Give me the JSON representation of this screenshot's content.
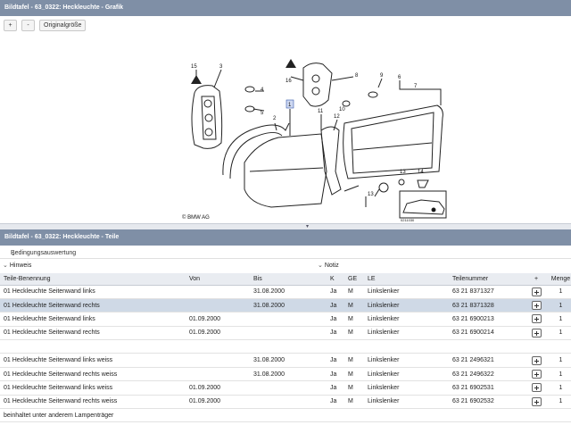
{
  "top_panel": {
    "title": "Bildtafel - 63_0322: Heckleuchte - Grafik"
  },
  "toolbar": {
    "zoom_in": "+",
    "zoom_out": "-",
    "original": "Originalgröße"
  },
  "diagram": {
    "callouts": [
      "15",
      "3",
      "4",
      "5",
      "16",
      "8",
      "9",
      "6",
      "7",
      "1",
      "2",
      "11",
      "12",
      "10",
      "13",
      "14",
      "13"
    ],
    "brand": "© BMW AG",
    "code": "0211030"
  },
  "bottom_panel": {
    "title": "Bildtafel - 63_0322: Heckleuchte - Teile"
  },
  "filters": {
    "conditions": "Bedingungsauswertung",
    "hint": "Hinweis",
    "notes": "Notiz"
  },
  "table": {
    "headers": [
      "Teile-Benennung",
      "Von",
      "Bis",
      "K",
      "GE",
      "LE",
      "Teilenummer",
      "+",
      "Menge"
    ],
    "rows": [
      {
        "name": "01 Heckleuchte Seitenwand links",
        "from": "",
        "to": "31.08.2000",
        "k": "Ja",
        "ge": "M",
        "le": "Linkslenker",
        "part": "63 21 8371327",
        "cart": true,
        "qty": "1",
        "selected": false
      },
      {
        "name": "01 Heckleuchte Seitenwand rechts",
        "from": "",
        "to": "31.08.2000",
        "k": "Ja",
        "ge": "M",
        "le": "Linkslenker",
        "part": "63 21 8371328",
        "cart": true,
        "qty": "1",
        "selected": true
      },
      {
        "name": "01 Heckleuchte Seitenwand links",
        "from": "01.09.2000",
        "to": "",
        "k": "Ja",
        "ge": "M",
        "le": "Linkslenker",
        "part": "63 21 6900213",
        "cart": true,
        "qty": "1",
        "selected": false
      },
      {
        "name": "01 Heckleuchte Seitenwand rechts",
        "from": "01.09.2000",
        "to": "",
        "k": "Ja",
        "ge": "M",
        "le": "Linkslenker",
        "part": "63 21 6900214",
        "cart": true,
        "qty": "1",
        "selected": false
      },
      {
        "name": "",
        "from": "",
        "to": "",
        "k": "",
        "ge": "",
        "le": "",
        "part": "",
        "cart": false,
        "qty": "",
        "selected": false
      },
      {
        "name": "01 Heckleuchte Seitenwand links weiss",
        "from": "",
        "to": "31.08.2000",
        "k": "Ja",
        "ge": "M",
        "le": "Linkslenker",
        "part": "63 21 2496321",
        "cart": true,
        "qty": "1",
        "selected": false
      },
      {
        "name": "01 Heckleuchte Seitenwand rechts weiss",
        "from": "",
        "to": "31.08.2000",
        "k": "Ja",
        "ge": "M",
        "le": "Linkslenker",
        "part": "63 21 2496322",
        "cart": true,
        "qty": "1",
        "selected": false
      },
      {
        "name": "01 Heckleuchte Seitenwand links weiss",
        "from": "01.09.2000",
        "to": "",
        "k": "Ja",
        "ge": "M",
        "le": "Linkslenker",
        "part": "63 21 6902531",
        "cart": true,
        "qty": "1",
        "selected": false
      },
      {
        "name": "01 Heckleuchte Seitenwand rechts weiss",
        "from": "01.09.2000",
        "to": "",
        "k": "Ja",
        "ge": "M",
        "le": "Linkslenker",
        "part": "63 21 6902532",
        "cart": true,
        "qty": "1",
        "selected": false
      },
      {
        "name": "beinhaltet unter anderem Lampenträger",
        "from": "",
        "to": "",
        "k": "",
        "ge": "",
        "le": "",
        "part": "",
        "cart": false,
        "qty": "",
        "selected": false
      }
    ]
  },
  "colors": {
    "titlebar": "#7f8fa6",
    "selected_row": "#cfd9e6",
    "header_bg": "#e9ecf1"
  }
}
